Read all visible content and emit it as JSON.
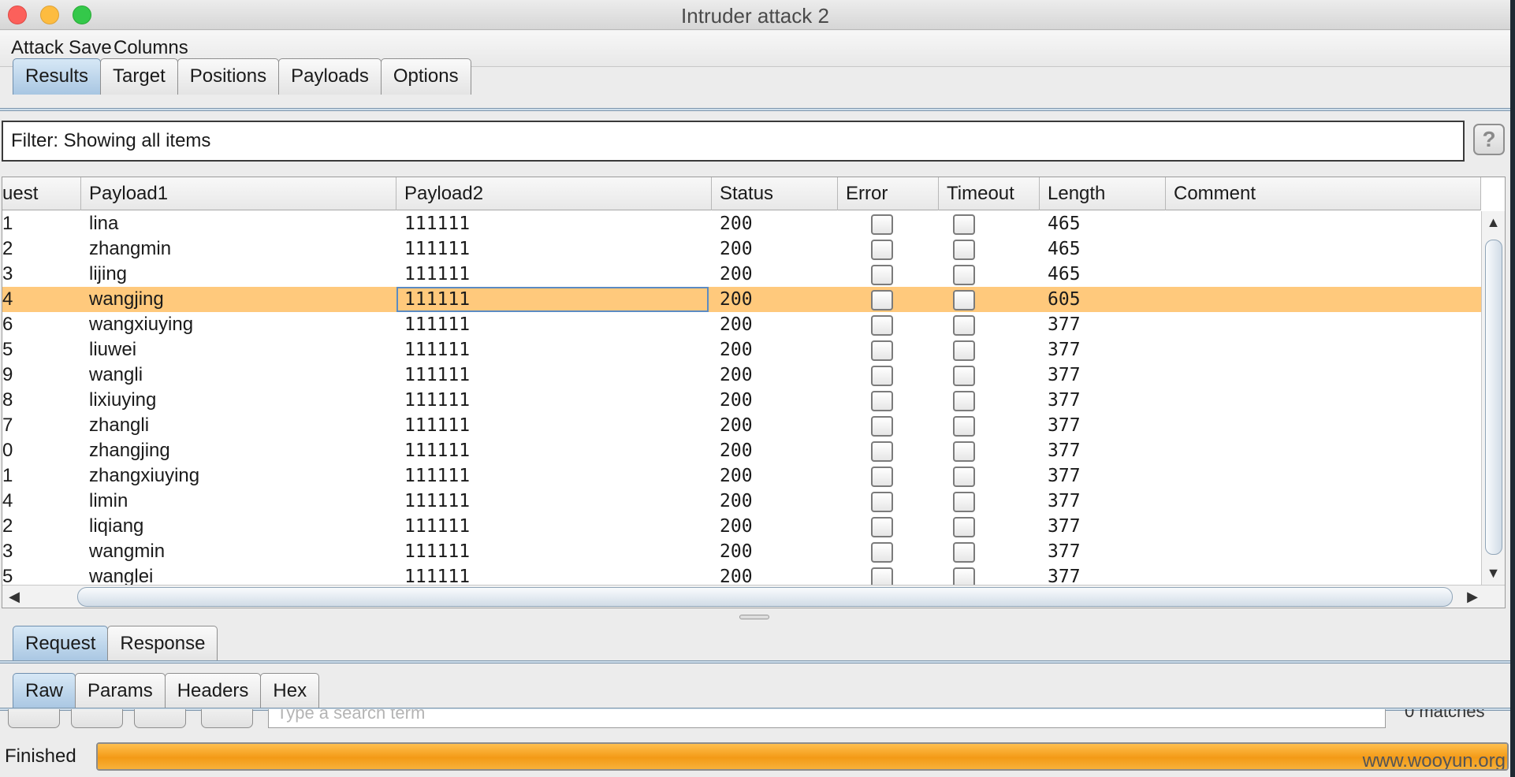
{
  "window": {
    "title": "Intruder attack 2"
  },
  "menu": [
    "Attack",
    "Save",
    "Columns"
  ],
  "tabs": [
    "Results",
    "Target",
    "Positions",
    "Payloads",
    "Options"
  ],
  "filter": {
    "text": "Filter: Showing all items",
    "help": "?"
  },
  "table": {
    "columns": [
      "uest",
      "Payload1",
      "Payload2",
      "Status",
      "Error",
      "Timeout",
      "Length",
      "Comment"
    ],
    "rows": [
      {
        "req": "1",
        "p1": "lina",
        "p2": "111111",
        "status": "200",
        "len": "465"
      },
      {
        "req": "2",
        "p1": "zhangmin",
        "p2": "111111",
        "status": "200",
        "len": "465"
      },
      {
        "req": "3",
        "p1": "lijing",
        "p2": "111111",
        "status": "200",
        "len": "465"
      },
      {
        "req": "4",
        "p1": "wangjing",
        "p2": "111111",
        "status": "200",
        "len": "605"
      },
      {
        "req": "6",
        "p1": "wangxiuying",
        "p2": "111111",
        "status": "200",
        "len": "377"
      },
      {
        "req": "5",
        "p1": "liuwei",
        "p2": "111111",
        "status": "200",
        "len": "377"
      },
      {
        "req": "9",
        "p1": "wangli",
        "p2": "111111",
        "status": "200",
        "len": "377"
      },
      {
        "req": "8",
        "p1": "lixiuying",
        "p2": "111111",
        "status": "200",
        "len": "377"
      },
      {
        "req": "7",
        "p1": "zhangli",
        "p2": "111111",
        "status": "200",
        "len": "377"
      },
      {
        "req": "0",
        "p1": "zhangjing",
        "p2": "111111",
        "status": "200",
        "len": "377"
      },
      {
        "req": "1",
        "p1": "zhangxiuying",
        "p2": "111111",
        "status": "200",
        "len": "377"
      },
      {
        "req": "4",
        "p1": "limin",
        "p2": "111111",
        "status": "200",
        "len": "377"
      },
      {
        "req": "2",
        "p1": "liqiang",
        "p2": "111111",
        "status": "200",
        "len": "377"
      },
      {
        "req": "3",
        "p1": "wangmin",
        "p2": "111111",
        "status": "200",
        "len": "377"
      },
      {
        "req": "5",
        "p1": "wanglei",
        "p2": "111111",
        "status": "200",
        "len": "377"
      }
    ]
  },
  "message_tabs": [
    "Request",
    "Response"
  ],
  "view_tabs": [
    "Raw",
    "Params",
    "Headers",
    "Hex"
  ],
  "search": {
    "placeholder": "Type a search term",
    "matches": "0 matches"
  },
  "status": {
    "text": "Finished",
    "progress": 1.0,
    "watermark": "www.wooyun.org"
  },
  "colors": {
    "selected_row": "#ffc97c",
    "progress": "#f39a16",
    "active_tab": "#a8c6e2"
  },
  "icons": [
    "close-light",
    "minimize-light",
    "zoom-light",
    "help-icon",
    "scroll-up-arrow",
    "scroll-down-arrow",
    "scroll-left-arrow",
    "scroll-right-arrow"
  ]
}
